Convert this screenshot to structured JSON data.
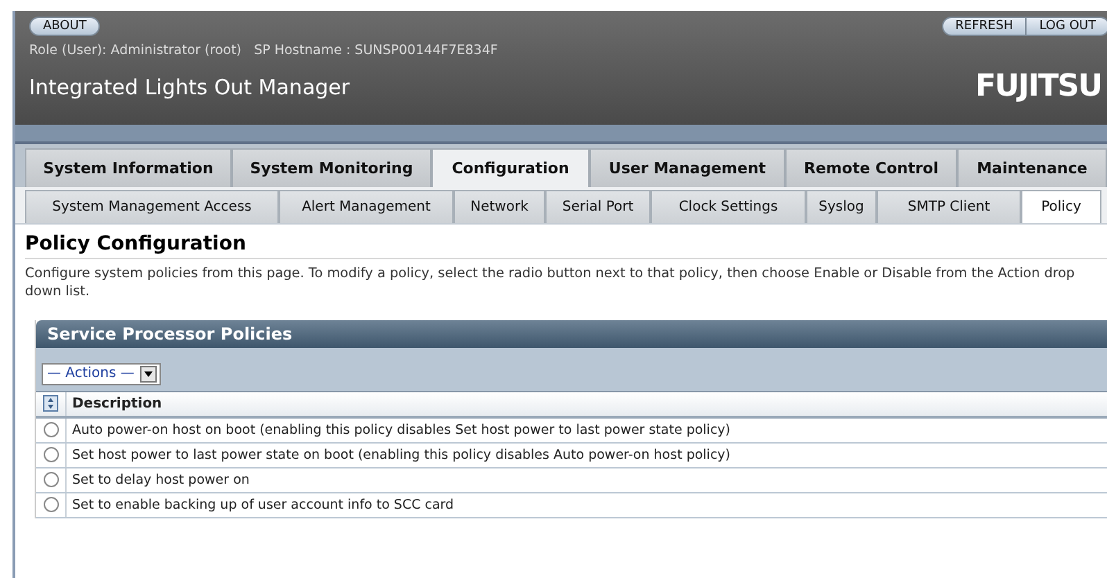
{
  "header": {
    "about_button": "ABOUT",
    "refresh_button": "REFRESH",
    "logout_button": "LOG OUT",
    "role_line": "Role (User): Administrator (root)   SP Hostname : SUNSP00144F7E834F",
    "title": "Integrated Lights Out Manager",
    "logo": "FUJITSU"
  },
  "tabs": [
    {
      "label": "System Information",
      "selected": false
    },
    {
      "label": "System Monitoring",
      "selected": false
    },
    {
      "label": "Configuration",
      "selected": true
    },
    {
      "label": "User Management",
      "selected": false
    },
    {
      "label": "Remote Control",
      "selected": false
    },
    {
      "label": "Maintenance",
      "selected": false
    }
  ],
  "subtabs": [
    {
      "label": "System Management Access",
      "selected": false
    },
    {
      "label": "Alert Management",
      "selected": false
    },
    {
      "label": "Network",
      "selected": false
    },
    {
      "label": "Serial Port",
      "selected": false
    },
    {
      "label": "Clock Settings",
      "selected": false
    },
    {
      "label": "Syslog",
      "selected": false
    },
    {
      "label": "SMTP Client",
      "selected": false
    },
    {
      "label": "Policy",
      "selected": true
    }
  ],
  "page": {
    "title": "Policy Configuration",
    "description": "Configure system policies from this page. To modify a policy, select the radio button next to that policy, then choose Enable or Disable from the Action drop down list."
  },
  "table": {
    "title": "Service Processor Policies",
    "actions_dropdown": "— Actions —",
    "columns": [
      "Description"
    ],
    "rows": [
      {
        "description": "Auto power-on host on boot (enabling this policy disables Set host power to last power state policy)",
        "selected": false
      },
      {
        "description": "Set host power to last power state on boot (enabling this policy disables Auto power-on host policy)",
        "selected": false
      },
      {
        "description": "Set to delay host power on",
        "selected": false
      },
      {
        "description": "Set to enable backing up of user account info to SCC card",
        "selected": false
      }
    ]
  }
}
